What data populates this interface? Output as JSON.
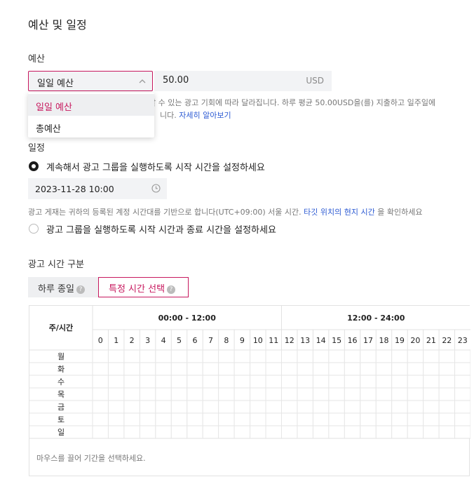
{
  "section_title": "예산 및 일정",
  "budget": {
    "label": "예산",
    "type_selected": "일일 예산",
    "amount": "50.00",
    "currency": "USD",
    "help_text_line1": "할 수 있는 광고 기회에 따라 달라집니다. 하루 평균 50.00USD을(를) 지출하고 일주일에",
    "help_text_line2": "니다.",
    "help_link": "자세히 알아보기",
    "dropdown_options": [
      "일일 예산",
      "총예산"
    ]
  },
  "schedule": {
    "label": "일정",
    "option_continuous": "계속해서 광고 그룹을 실행하도록 시작 시간을 설정하세요",
    "start_datetime": "2023-11-28 10:00",
    "timezone_note_prefix": "광고 게재는 귀하의 등록된 계정 시간대를 기반으로 합니다(UTC+09:00) 서울 시간.",
    "timezone_note_link": "타깃 위치의 현지 시간",
    "timezone_note_suffix": "을 확인하세요",
    "option_range": "광고 그룹을 실행하도록 시작 시간과 종료 시간을 설정하세요"
  },
  "dayparting": {
    "label": "광고 시간 구분",
    "tab_all_day": "하루 종일",
    "tab_specific": "특정 시간 선택",
    "corner_header": "주/시간",
    "range_am": "00:00 - 12:00",
    "range_pm": "12:00 - 24:00",
    "hours": [
      "0",
      "1",
      "2",
      "3",
      "4",
      "5",
      "6",
      "7",
      "8",
      "9",
      "10",
      "11",
      "12",
      "13",
      "14",
      "15",
      "16",
      "17",
      "18",
      "19",
      "20",
      "21",
      "22",
      "23"
    ],
    "days": [
      "월",
      "화",
      "수",
      "목",
      "금",
      "토",
      "일"
    ],
    "footer_hint": "마우스를 끌어 기간을 선택하세요."
  },
  "colors": {
    "accent": "#c7185e",
    "link": "#2d5bd3",
    "field_bg": "#f2f3f5"
  }
}
